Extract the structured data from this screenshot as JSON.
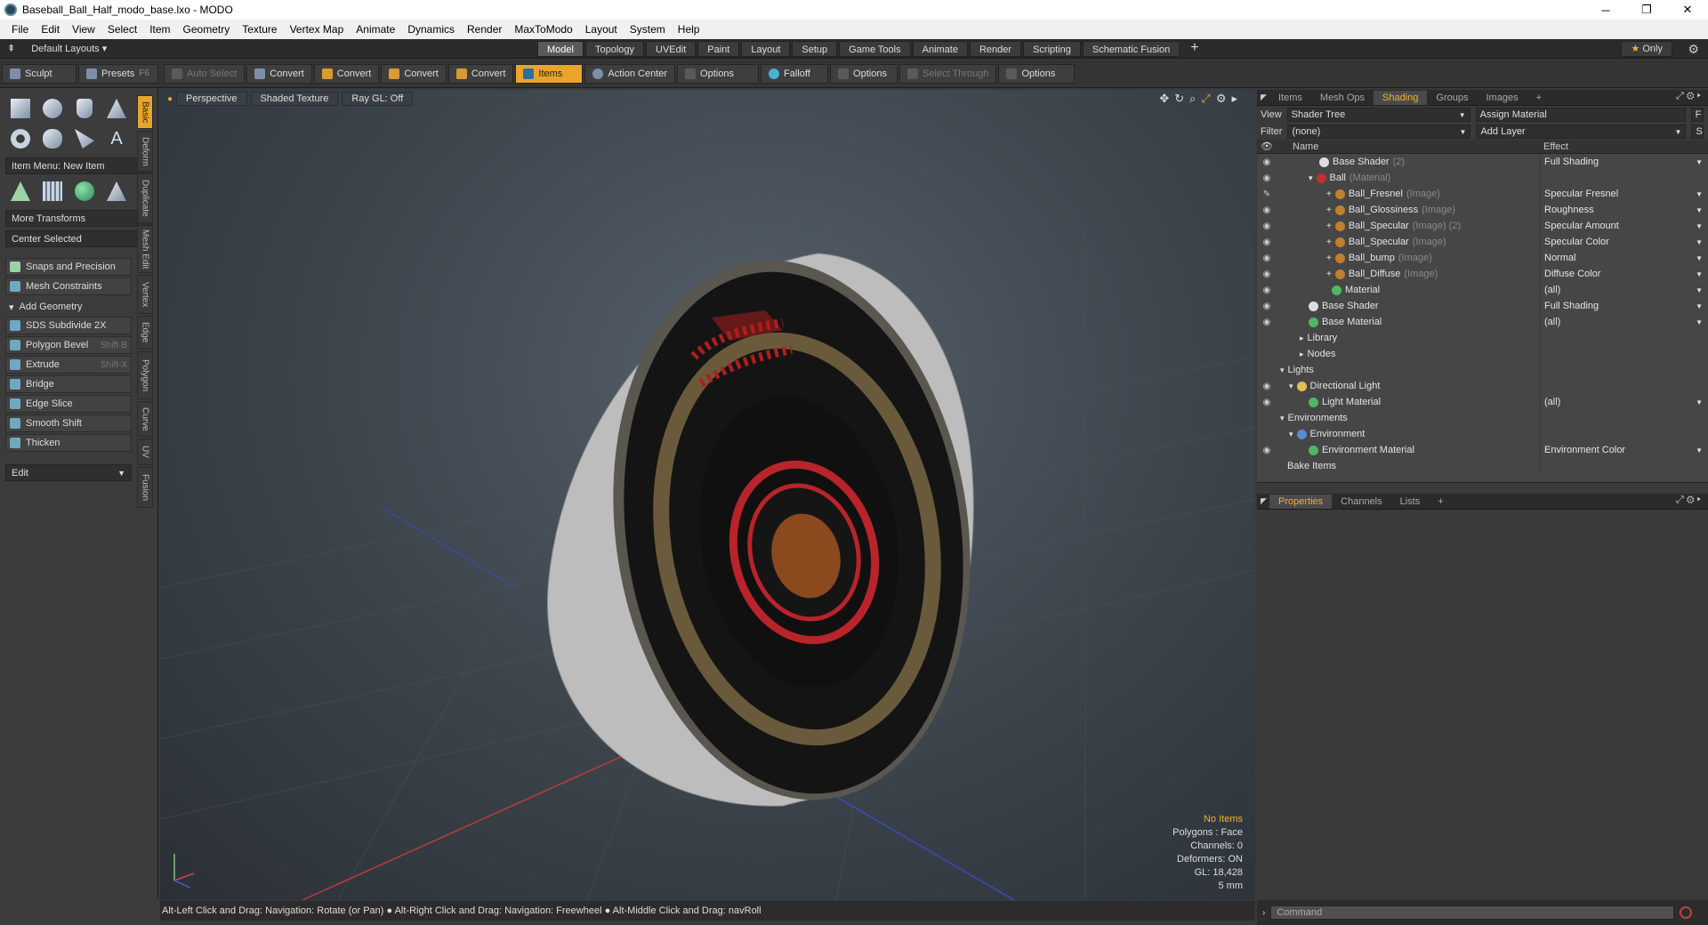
{
  "window": {
    "title": "Baseball_Ball_Half_modo_base.lxo - MODO",
    "min": "─",
    "max": "❐",
    "close": "✕"
  },
  "menu": [
    "File",
    "Edit",
    "View",
    "Select",
    "Item",
    "Geometry",
    "Texture",
    "Vertex Map",
    "Animate",
    "Dynamics",
    "Render",
    "MaxToModo",
    "Layout",
    "System",
    "Help"
  ],
  "layoutbar": {
    "layouts": "Default Layouts",
    "tabs": [
      "Model",
      "Topology",
      "UVEdit",
      "Paint",
      "Layout",
      "Setup",
      "Game Tools",
      "Animate",
      "Render",
      "Scripting",
      "Schematic Fusion"
    ],
    "active_tab": "Model",
    "only": "Only"
  },
  "toolbar": {
    "sculpt": "Sculpt",
    "presets": "Presets",
    "presets_key": "F6",
    "auto_select": "Auto Select",
    "convert1": "Convert",
    "convert2": "Convert",
    "convert3": "Convert",
    "convert4": "Convert",
    "items": "Items",
    "action_center": "Action Center",
    "options1": "Options",
    "falloff": "Falloff",
    "options2": "Options",
    "select_through": "Select Through",
    "options3": "Options"
  },
  "left": {
    "item_menu": "Item Menu: New Item",
    "more_transforms": "More Transforms",
    "center_selected": "Center Selected",
    "snaps": "Snaps and Precision",
    "mesh_constraints": "Mesh Constraints",
    "add_geometry": "Add Geometry",
    "tools": [
      {
        "label": "SDS Subdivide 2X",
        "key": ""
      },
      {
        "label": "Polygon Bevel",
        "key": "Shift-B"
      },
      {
        "label": "Extrude",
        "key": "Shift-X"
      },
      {
        "label": "Bridge",
        "key": ""
      },
      {
        "label": "Edge Slice",
        "key": ""
      },
      {
        "label": "Smooth Shift",
        "key": ""
      },
      {
        "label": "Thicken",
        "key": ""
      }
    ],
    "edit": "Edit",
    "side_tabs": [
      "Basic",
      "Deform",
      "Duplicate",
      "Mesh Edit",
      "Vertex",
      "Edge",
      "Polygon",
      "Curve",
      "UV",
      "Fusion"
    ]
  },
  "viewport": {
    "perspective": "Perspective",
    "shading": "Shaded Texture",
    "raygl": "Ray GL: Off",
    "stats": {
      "no_items": "No Items",
      "polygons": "Polygons : Face",
      "channels": "Channels: 0",
      "deformers": "Deformers: ON",
      "gl": "GL: 18,428",
      "scale": "5 mm"
    }
  },
  "status": "Alt-Left Click and Drag: Navigation: Rotate (or Pan) ● Alt-Right Click and Drag: Navigation: Freewheel ● Alt-Middle Click and Drag: navRoll",
  "right": {
    "tabs": [
      "Items",
      "Mesh Ops",
      "Shading",
      "Groups",
      "Images"
    ],
    "active_tab": "Shading",
    "view_label": "View",
    "view_value": "Shader Tree",
    "assign": "Assign Material",
    "f_key": "F",
    "filter_label": "Filter",
    "filter_value": "(none)",
    "add_layer": "Add Layer",
    "s_key": "S",
    "col_name": "Name",
    "col_effect": "Effect",
    "rows": [
      {
        "name": "Base Shader",
        "sub": "(2)",
        "effect": "Full Shading"
      },
      {
        "name": "Ball",
        "sub": "(Material)",
        "effect": ""
      },
      {
        "name": "Ball_Fresnel",
        "sub": "(Image)",
        "effect": "Specular Fresnel"
      },
      {
        "name": "Ball_Glossiness",
        "sub": "(Image)",
        "effect": "Roughness"
      },
      {
        "name": "Ball_Specular",
        "sub": "(Image) (2)",
        "effect": "Specular Amount"
      },
      {
        "name": "Ball_Specular",
        "sub": "(Image)",
        "effect": "Specular Color"
      },
      {
        "name": "Ball_bump",
        "sub": "(Image)",
        "effect": "Normal"
      },
      {
        "name": "Ball_Diffuse",
        "sub": "(Image)",
        "effect": "Diffuse Color"
      },
      {
        "name": "Material",
        "sub": "",
        "effect": "(all)"
      },
      {
        "name": "Base Shader",
        "sub": "",
        "effect": "Full Shading"
      },
      {
        "name": "Base Material",
        "sub": "",
        "effect": "(all)"
      },
      {
        "name": "Library",
        "sub": "",
        "effect": ""
      },
      {
        "name": "Nodes",
        "sub": "",
        "effect": ""
      },
      {
        "name": "Lights",
        "sub": "",
        "effect": ""
      },
      {
        "name": "Directional Light",
        "sub": "",
        "effect": ""
      },
      {
        "name": "Light Material",
        "sub": "",
        "effect": "(all)"
      },
      {
        "name": "Environments",
        "sub": "",
        "effect": ""
      },
      {
        "name": "Environment",
        "sub": "",
        "effect": ""
      },
      {
        "name": "Environment Material",
        "sub": "",
        "effect": "Environment Color"
      },
      {
        "name": "Bake Items",
        "sub": "",
        "effect": ""
      }
    ],
    "prop_tabs": [
      "Properties",
      "Channels",
      "Lists"
    ],
    "command": "Command"
  }
}
